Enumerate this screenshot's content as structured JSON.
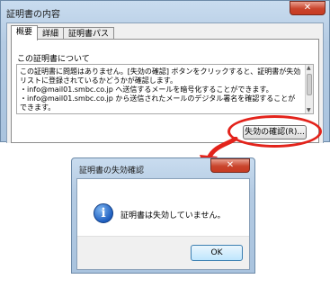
{
  "cert_window": {
    "title": "証明書の内容",
    "close_glyph": "✕",
    "tabs": [
      "概要",
      "詳細",
      "証明書パス"
    ],
    "group_title": "この証明書について",
    "description": "この証明書に問題はありません。[失効の確認] ボタンをクリックすると、証明書が失効リストに登録されているかどうかが確認します。\n・info@mail01.smbc.co.jp へ送信するメールを暗号化することができます。\n・info@mail01.smbc.co.jp から送信されたメールのデジタル署名を確認することができます。",
    "revoke_button": "失効の確認(R)..."
  },
  "dialog": {
    "title": "証明書の失効確認",
    "close_glyph": "✕",
    "icon": "info-icon",
    "icon_glyph": "i",
    "message": "証明書は失効していません。",
    "ok_button": "OK"
  },
  "colors": {
    "highlight": "#e3231b",
    "close_button": "#c9442c"
  }
}
